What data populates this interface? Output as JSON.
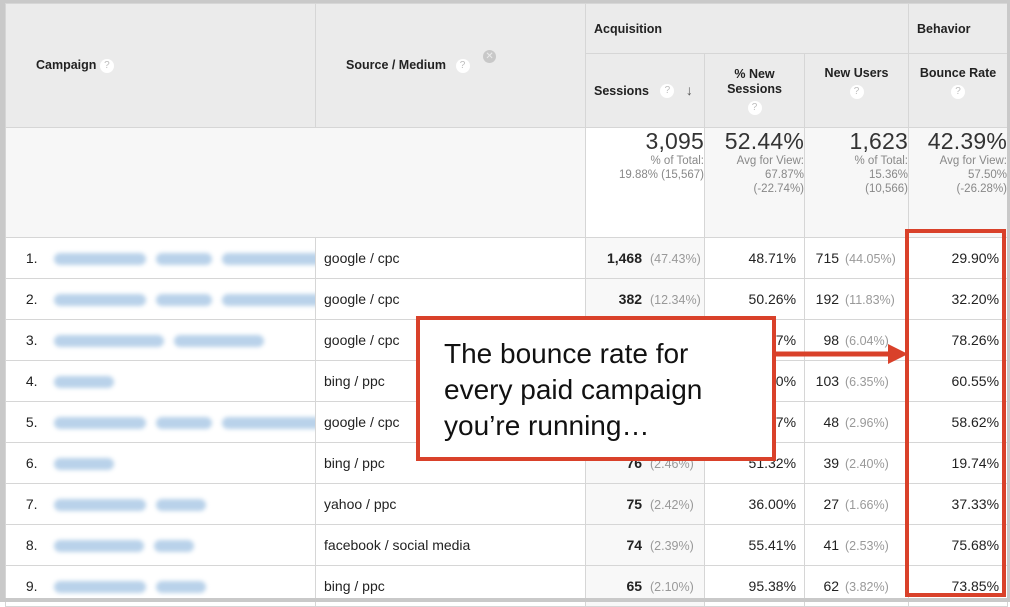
{
  "headers": {
    "campaign": "Campaign",
    "source_medium": "Source / Medium",
    "acquisition": "Acquisition",
    "behavior": "Behavior",
    "sessions": "Sessions",
    "pct_new_sessions": "% New Sessions",
    "new_users": "New Users",
    "bounce_rate": "Bounce Rate",
    "help_glyph": "?",
    "remove_glyph": "✕",
    "sort_glyph": "↓"
  },
  "totals": {
    "sessions": {
      "value": "3,095",
      "sub": "% of Total:\n19.88% (15,567)"
    },
    "pct_new_sessions": {
      "value": "52.44%",
      "sub": "Avg for View:\n67.87%\n(-22.74%)"
    },
    "new_users": {
      "value": "1,623",
      "sub": "% of Total:\n15.36%\n(10,566)"
    },
    "bounce_rate": {
      "value": "42.39%",
      "sub": "Avg for View:\n57.50%\n(-26.28%)"
    }
  },
  "rows": [
    {
      "idx": "1.",
      "source": "google / cpc",
      "sessions": "1,468",
      "sessions_pct": "(47.43%)",
      "pct_new": "48.71%",
      "new_users": "715",
      "new_users_pct": "(44.05%)",
      "bounce": "29.90%"
    },
    {
      "idx": "2.",
      "source": "google / cpc",
      "sessions": "382",
      "sessions_pct": "(12.34%)",
      "pct_new": "50.26%",
      "new_users": "192",
      "new_users_pct": "(11.83%)",
      "bounce": "32.20%"
    },
    {
      "idx": "3.",
      "source": "google / cpc",
      "sessions": "",
      "sessions_pct": "",
      "pct_new": "7%",
      "new_users": "98",
      "new_users_pct": "(6.04%)",
      "bounce": "78.26%"
    },
    {
      "idx": "4.",
      "source": "bing / ppc",
      "sessions": "",
      "sessions_pct": "",
      "pct_new": "0%",
      "new_users": "103",
      "new_users_pct": "(6.35%)",
      "bounce": "60.55%"
    },
    {
      "idx": "5.",
      "source": "google / cpc",
      "sessions": "",
      "sessions_pct": "",
      "pct_new": "7%",
      "new_users": "48",
      "new_users_pct": "(2.96%)",
      "bounce": "58.62%"
    },
    {
      "idx": "6.",
      "source": "bing / ppc",
      "sessions": "76",
      "sessions_pct": "(2.46%)",
      "pct_new": "51.32%",
      "new_users": "39",
      "new_users_pct": "(2.40%)",
      "bounce": "19.74%"
    },
    {
      "idx": "7.",
      "source": "yahoo / ppc",
      "sessions": "75",
      "sessions_pct": "(2.42%)",
      "pct_new": "36.00%",
      "new_users": "27",
      "new_users_pct": "(1.66%)",
      "bounce": "37.33%"
    },
    {
      "idx": "8.",
      "source": "facebook / social media",
      "sessions": "74",
      "sessions_pct": "(2.39%)",
      "pct_new": "55.41%",
      "new_users": "41",
      "new_users_pct": "(2.53%)",
      "bounce": "75.68%"
    },
    {
      "idx": "9.",
      "source": "bing / ppc",
      "sessions": "65",
      "sessions_pct": "(2.10%)",
      "pct_new": "95.38%",
      "new_users": "62",
      "new_users_pct": "(3.82%)",
      "bounce": "73.85%"
    }
  ],
  "campaign_names_redacted": true,
  "callout": {
    "text": "The bounce rate for\nevery paid campaign\nyou’re running…",
    "color": "#d9412a"
  }
}
